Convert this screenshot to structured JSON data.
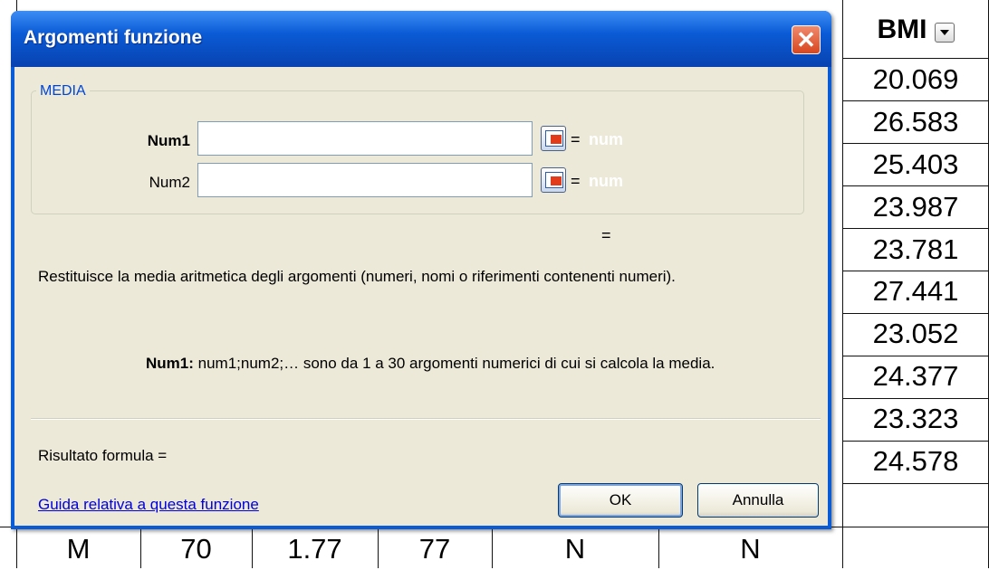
{
  "spreadsheet": {
    "header": {
      "bmi_label": "BMI",
      "filter_icon": "dropdown-arrow-icon"
    },
    "bmi_values": [
      "20.069",
      "26.583",
      "25.403",
      "23.987",
      "23.781",
      "27.441",
      "23.052",
      "24.377",
      "23.323",
      "24.578"
    ],
    "bottom_row": [
      "M",
      "70",
      "1.77",
      "77",
      "N",
      "N"
    ]
  },
  "dialog": {
    "title": "Argomenti funzione",
    "close_icon": "close-icon",
    "group_label": "MEDIA",
    "args": [
      {
        "label": "Num1",
        "value": "",
        "equals": "=",
        "result_hint": "num"
      },
      {
        "label": "Num2",
        "value": "",
        "equals": "=",
        "result_hint": "num"
      }
    ],
    "collapse_icon": "collapse-dialog-icon",
    "overall_equals": "=",
    "description": "Restituisce la media aritmetica degli argomenti (numeri, nomi o riferimenti contenenti numeri).",
    "arg_help": {
      "name": "Num1:",
      "text": " num1;num2;… sono da 1 a 30 argomenti numerici di cui si calcola la media."
    },
    "result_label": "Risultato formula =",
    "help_link": "Guida relativa a questa funzione",
    "ok_label": "OK",
    "cancel_label": "Annulla"
  }
}
